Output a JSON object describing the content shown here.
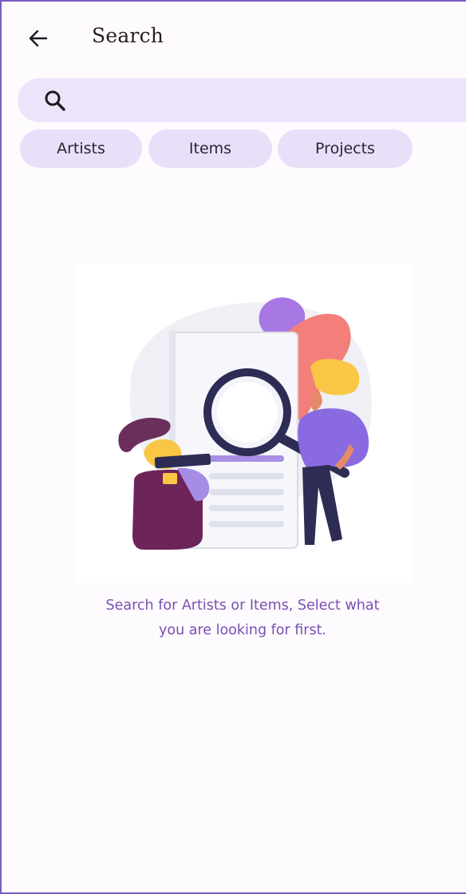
{
  "header": {
    "back_icon": "arrow-left-icon",
    "title": "Search"
  },
  "search": {
    "icon": "search-icon",
    "placeholder": "",
    "value": ""
  },
  "filters": [
    {
      "label": "Artists"
    },
    {
      "label": "Items"
    },
    {
      "label": "Projects"
    }
  ],
  "empty_state": {
    "illustration": "search-illustration",
    "message_line1": "Search for Artists or Items, Select what",
    "message_line2": "you are looking for first."
  },
  "colors": {
    "accent": "#7a4fb0",
    "chip_bg": "#eadff8",
    "search_bg": "#ede3fb",
    "border": "#7b5cc4"
  }
}
